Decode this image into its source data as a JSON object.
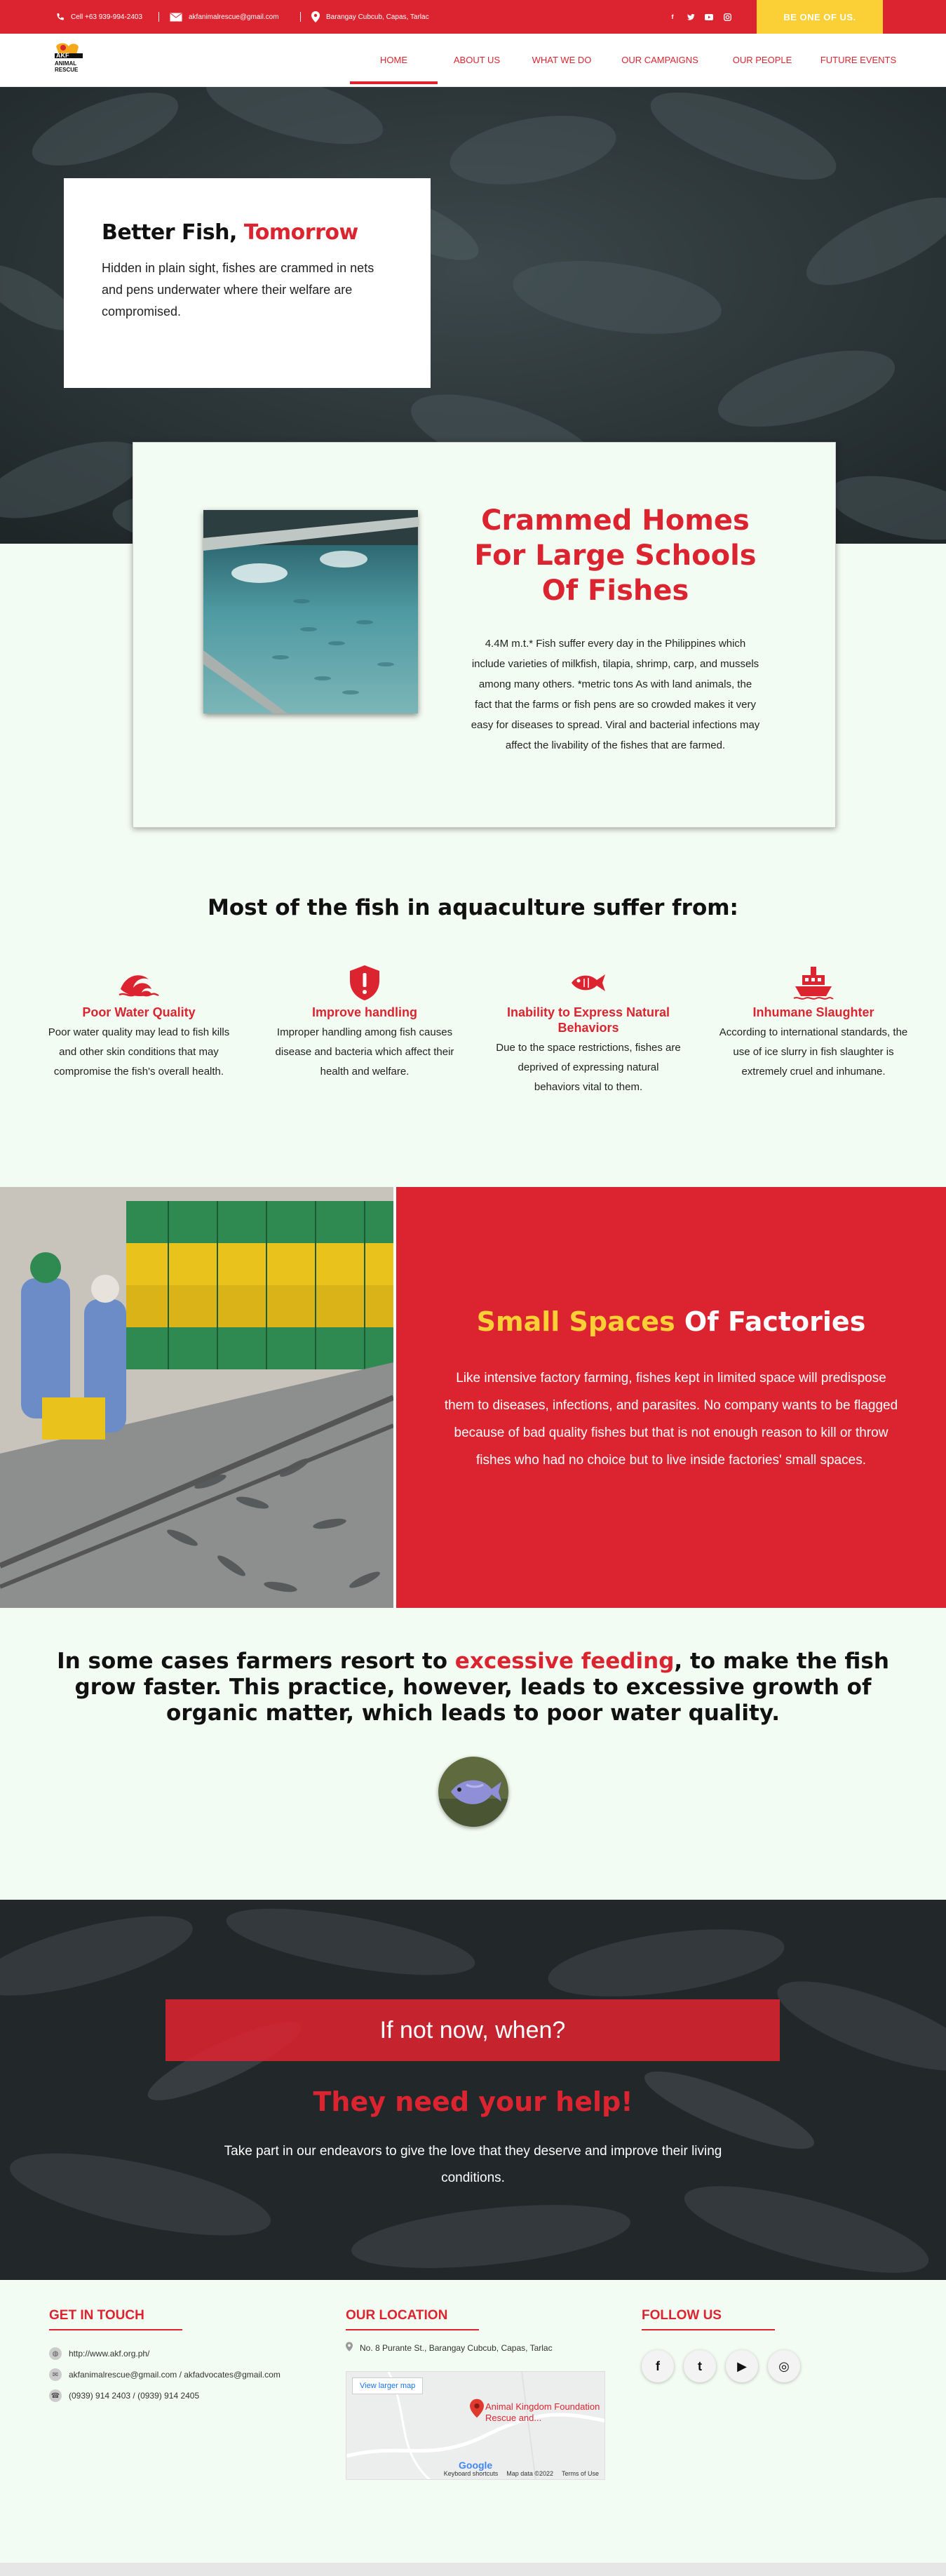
{
  "topbar": {
    "phone": "Cell +63 939-994-2403",
    "email": "akfanimalrescue@gmail.com",
    "address": "Barangay Cubcub, Capas, Tarlac",
    "social": [
      "facebook-icon",
      "twitter-icon",
      "youtube-icon",
      "instagram-icon"
    ],
    "cta": "BE ONE OF US."
  },
  "logo": {
    "line1": "AKF",
    "line2": "ANIMAL",
    "line3": "RESCUE"
  },
  "nav": [
    "HOME",
    "ABOUT US",
    "WHAT WE DO",
    "OUR CAMPAIGNS",
    "OUR PEOPLE",
    "FUTURE EVENTS"
  ],
  "hero": {
    "title_plain": "Better Fish, ",
    "title_accent": "Tomorrow",
    "text": "Hidden in plain sight, fishes are crammed in nets and pens underwater where their welfare are compromised."
  },
  "crammed": {
    "title": "Crammed Homes For Large Schools Of Fishes",
    "text": "4.4M m.t.* Fish suffer every day in the Philippines which include varieties of milkfish, tilapia, shrimp, carp, and mussels among many others. *metric tons As with land animals, the fact that the farms or fish pens are so crowded makes it very easy for diseases to spread. Viral and bacterial infections may affect the livability of the fishes that are farmed."
  },
  "suffer": {
    "title": "Most of the fish in aquaculture suffer from:",
    "items": [
      {
        "icon": "water-wave-icon",
        "title": "Poor Water Quality",
        "text": "Poor water quality may lead to fish kills and other skin conditions that may compromise the fish's overall health."
      },
      {
        "icon": "warning-shield-icon",
        "title": "Improve handling",
        "text": "Improper handling among fish causes disease and bacteria which affect their health and welfare."
      },
      {
        "icon": "fish-icon",
        "title": "Inability to Express Natural Behaviors",
        "text": "Due to the space restrictions, fishes are deprived of expressing natural behaviors vital to them."
      },
      {
        "icon": "ship-icon",
        "title": "Inhumane Slaughter",
        "text": "According to international standards, the use of ice slurry in fish slaughter is extremely cruel and inhumane."
      }
    ]
  },
  "factories": {
    "title_accent": "Small Spaces",
    "title_plain": " Of Factories",
    "text": "Like intensive factory farming, fishes kept in limited space will predispose them to diseases, infections, and parasites. No company wants to be flagged because of bad quality fishes but that is not enough reason to kill or throw fishes who had no choice but to live inside factories' small spaces."
  },
  "feeding": {
    "before": "In some cases farmers resort to ",
    "accent": "excessive feeding",
    "after": ", to make the fish grow faster. This practice, however, leads to excessive growth of organic matter, which leads to poor water quality."
  },
  "help": {
    "box": "If not now, when?",
    "title": "They need your help!",
    "text": "Take part in our endeavors to give the love that they deserve and improve their living conditions."
  },
  "footer": {
    "touch_head": "GET IN TOUCH",
    "website": "http://www.akf.org.ph/",
    "emails": "akfanimalrescue@gmail.com / akfadvocates@gmail.com",
    "phones": "(0939) 914 2403 / (0939) 914 2405",
    "location_head": "OUR LOCATION",
    "address": "No. 8 Purante St., Barangay Cubcub, Capas, Tarlac",
    "map_button": "View larger map",
    "map_label": "Animal Kingdom Foundation Rescue and...",
    "map_brand": "Google",
    "map_footer": [
      "Keyboard shortcuts",
      "Map data ©2022",
      "Terms of Use"
    ],
    "follow_head": "FOLLOW US",
    "social": [
      {
        "icon": "facebook-icon",
        "glyph": "f"
      },
      {
        "icon": "twitter-icon",
        "glyph": "t"
      },
      {
        "icon": "youtube-icon",
        "glyph": "▶"
      },
      {
        "icon": "instagram-icon",
        "glyph": "◎"
      }
    ]
  }
}
